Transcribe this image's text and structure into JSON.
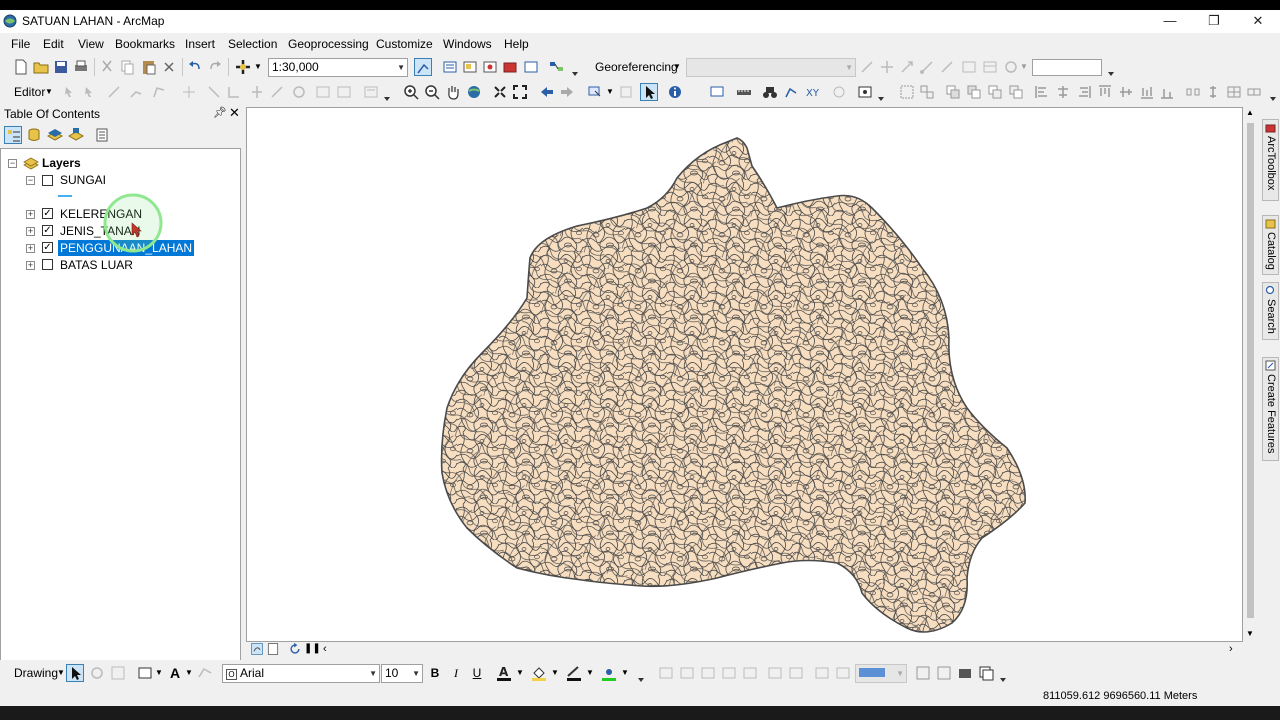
{
  "window": {
    "title": "SATUAN LAHAN - ArcMap",
    "minimize": "—",
    "restore": "❐",
    "close": "✕"
  },
  "menu": [
    "File",
    "Edit",
    "View",
    "Bookmarks",
    "Insert",
    "Selection",
    "Geoprocessing",
    "Customize",
    "Windows",
    "Help"
  ],
  "standard_toolbar": {
    "scale": "1:30,000",
    "georeferencing_label": "Georeferencing",
    "georef_layer": "",
    "georef_scale": ""
  },
  "editor_toolbar": {
    "editor_label": "Editor"
  },
  "toc": {
    "title": "Table Of Contents",
    "root_label": "Layers",
    "layers": [
      {
        "name": "SUNGAI",
        "checked": false,
        "expanded": true
      },
      {
        "name": "KELERENGAN",
        "checked": true,
        "expanded": false
      },
      {
        "name": "JENIS_TANAH",
        "checked": true,
        "expanded": false
      },
      {
        "name": "PENGGUNAAN_LAHAN",
        "checked": true,
        "expanded": false,
        "selected": true
      },
      {
        "name": "BATAS LUAR",
        "checked": false,
        "expanded": false
      }
    ]
  },
  "right_dock": [
    "ArcToolbox",
    "Catalog",
    "Search",
    "Create Features"
  ],
  "drawing_toolbar": {
    "drawing_label": "Drawing",
    "font": "Arial",
    "font_size": "10"
  },
  "status": {
    "coordinates": "811059.612  9696560.11 Meters"
  },
  "colors": {
    "polygon_fill": "#f8dec0",
    "polygon_outline": "#4a4a4a",
    "selection": "#0078d7",
    "sungai_symbol": "#43b0f0"
  }
}
